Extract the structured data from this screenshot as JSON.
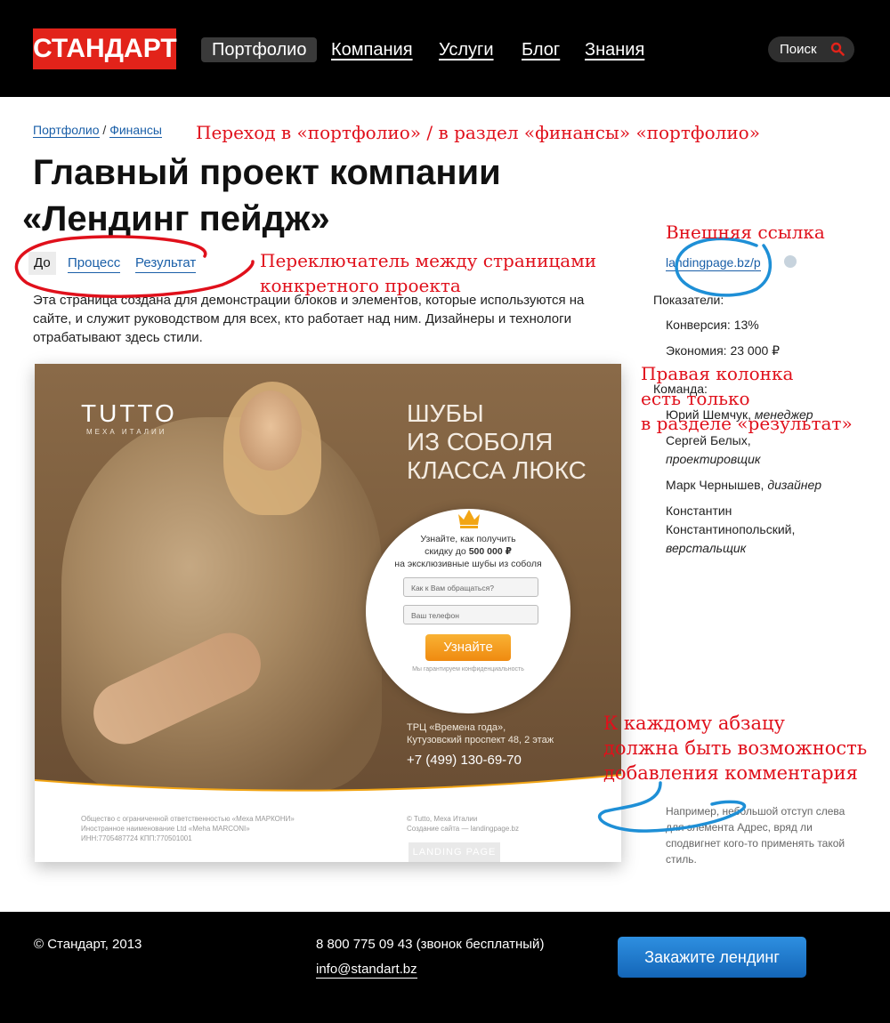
{
  "header": {
    "logo": "СТАНДАРТ",
    "nav": [
      "Портфолио",
      "Компания",
      "Услуги",
      "Блог",
      "Знания"
    ],
    "search_label": "Поиск"
  },
  "breadcrumb": {
    "item1": "Портфолио",
    "separator": "/",
    "item2": "Финансы"
  },
  "title_line1": "Главный проект компании",
  "title_line2": "«Лендинг пейдж»",
  "tabs": [
    "До",
    "Процесс",
    "Результат"
  ],
  "intro": "Эта страница создана для демонстрации блоков и элементов, которые используются на сайте, и служит руководством для всех, кто работает над ним. Дизайнеры и технологи отрабатывают здесь стили.",
  "preview": {
    "brand": "TUTTO",
    "brand_sub": "МЕХА ИТАЛИИ",
    "headline": [
      "ШУБЫ",
      "ИЗ СОБОЛЯ",
      "КЛАССА ЛЮКС"
    ],
    "offer_line1": "Узнайте, как получить",
    "offer_line2_prefix": "скидку до ",
    "offer_amount": "500 000 ₽",
    "offer_line3": "на эксклюзивные шубы из соболя",
    "name_placeholder": "Как к Вам обращаться?",
    "phone_placeholder": "Ваш телефон",
    "submit": "Узнайте",
    "privacy": "Мы гарантируем конфиденциальность",
    "address_line1": "ТРЦ «Времена года»,",
    "address_line2": "Кутузовский проспект 48, 2 этаж",
    "phone": "+7 (499) 130-69-70",
    "legal_left_1": "Общество с ограниченной ответственностью «Меха МАРКОНИ»",
    "legal_left_2": "Иностранное наименование Ltd «Meha MARCONI»",
    "legal_left_3": "ИНН:7705487724 КПП:770501001",
    "legal_right_1": "© Tutto, Меха Италии",
    "legal_right_2": "Создание сайта — landingpage.bz",
    "badge": "LANDING PAGE"
  },
  "sidebar": {
    "external_link": "landingpage.bz/p",
    "metrics_label": "Показатели:",
    "conversion": "Конверсия: 13%",
    "savings": "Экономия: 23 000 ₽",
    "team_label": "Команда:",
    "team": [
      {
        "name": "Юрий Шемчук, ",
        "role": "менеджер"
      },
      {
        "name": "Сергей Белых, ",
        "role": "проектировщик"
      },
      {
        "name": "Марк Чернышев, ",
        "role": "дизайнер"
      },
      {
        "name": "Константин Константинопольский, ",
        "role": "верстальщик"
      }
    ],
    "comment": "Например, небольшой отступ слева для элемента Адрес, вряд ли сподвигнет кого-то применять такой стиль."
  },
  "annotations": {
    "breadcrumb_note": "Переход в «портфолио» / в раздел «финансы» «портфолио»",
    "tabs_note_1": "Переключатель между страницами",
    "tabs_note_2": "конкретного проекта",
    "external_note": "Внешняя ссылка",
    "right_col_note_1": "Правая колонка",
    "right_col_note_2": "есть только",
    "right_col_note_3": "в разделе «результат»",
    "comment_note_1": "К каждому абзацу",
    "comment_note_2": "должна быть возможность",
    "comment_note_3": "добавления комментария"
  },
  "footer": {
    "copyright": "© Стандарт, 2013",
    "phone": "8 800 775 09 43 (звонок бесплатный)",
    "email": "info@standart.bz",
    "cta": "Закажите лендинг"
  },
  "colors": {
    "brand_red": "#e2231a",
    "link_blue": "#1a5fa8",
    "annotation_red": "#e0101b",
    "annotation_blue": "#1e8fd6",
    "cta_blue": "#1a78cc"
  }
}
